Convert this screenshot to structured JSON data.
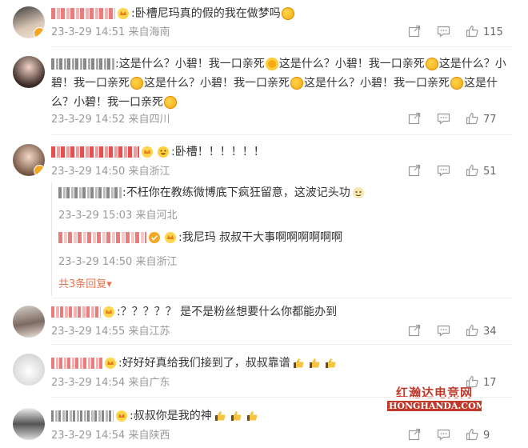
{
  "comments": [
    {
      "text": ":卧槽尼玛真的假的我在做梦吗",
      "time": "23-3-29 14:51",
      "location": "来自海南",
      "likes": "115"
    },
    {
      "text_parts": [
        ":这是什么？小碧！我一口亲死",
        "这是什么？小碧！我一口亲死",
        "这是什么？小碧！我一口亲死",
        "这是什么？小碧！我一口亲死",
        "这是什么？小碧！我一口亲死",
        "这是什么？小碧！我一口亲死"
      ],
      "time": "23-3-29 14:52",
      "location": "来自四川",
      "likes": "77"
    },
    {
      "text": ":卧槽！！！！！！",
      "time": "23-3-29 14:50",
      "location": "来自浙江",
      "likes": "51",
      "replies": [
        {
          "text": ":不枉你在教练微博底下疯狂留意，这波记头功",
          "time": "23-3-29 15:03",
          "location": "来自河北"
        },
        {
          "text": ":我尼玛 叔叔干大事啊啊啊啊啊啊",
          "time": "23-3-29 14:50",
          "location": "来自浙江"
        }
      ],
      "more_replies": "共3条回复"
    },
    {
      "text": ":？？？？？ 是不是粉丝想要什么你都能办到",
      "time": "23-3-29 14:55",
      "location": "来自江苏",
      "likes": "34"
    },
    {
      "text": ":好好好真给我们接到了，叔叔靠谱",
      "time": "23-3-29 14:54",
      "location": "来自广东",
      "likes": "17"
    },
    {
      "text": ":叔叔你是我的神",
      "time": "23-3-29 14:54",
      "location": "来自陕西",
      "likes": "9"
    }
  ],
  "watermark": {
    "line1": "红瀚达电竞网",
    "line2": "HONGHANDA.COM"
  },
  "colors": {
    "accent": "#eb7350",
    "meta_gray": "#999999",
    "vip_badge": "#f5a623"
  },
  "icons": [
    "share-icon",
    "comment-icon",
    "like-icon",
    "vip-crown-icon",
    "heart-eyes-emoji",
    "thumbs-up-emoji",
    "grin-emoji"
  ]
}
